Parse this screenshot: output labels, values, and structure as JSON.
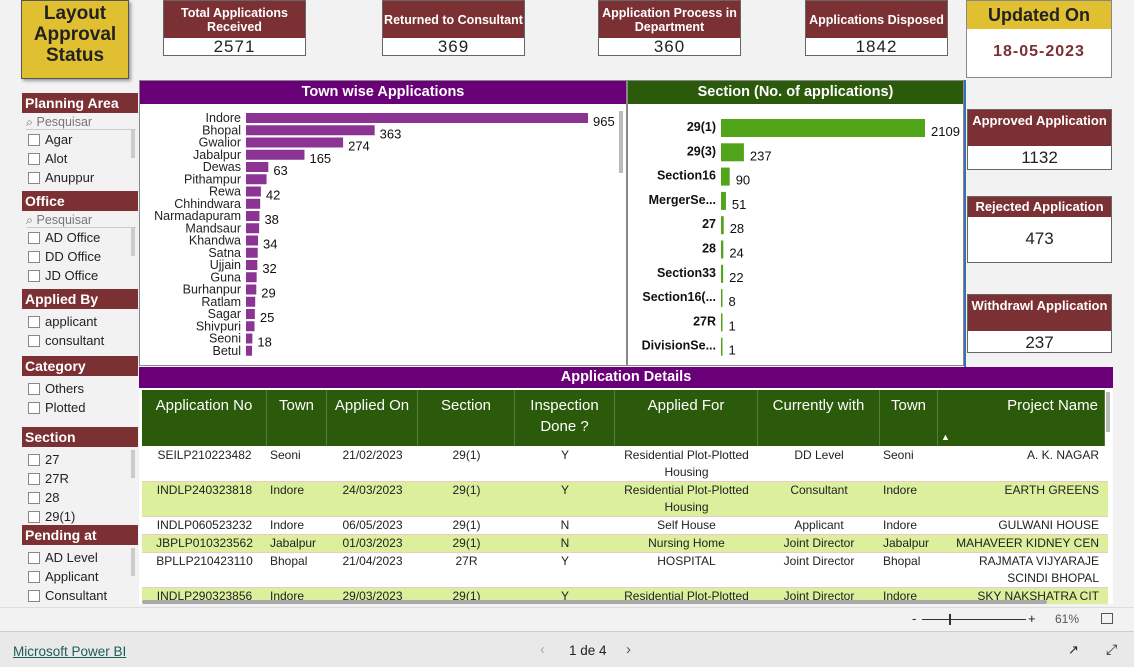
{
  "title": "Layout Approval Status",
  "kpis": [
    {
      "label": "Total Applications Received",
      "value": "2571"
    },
    {
      "label": "Returned to Consultant",
      "value": "369"
    },
    {
      "label": "Application Process in Department",
      "value": "360"
    },
    {
      "label": "Applications Disposed",
      "value": "1842"
    }
  ],
  "updated": {
    "label": "Updated On",
    "value": "18-05-2023"
  },
  "right_cards": [
    {
      "label": "Approved Application",
      "value": "1132"
    },
    {
      "label": "Rejected Application",
      "value": "473"
    },
    {
      "label": "Withdrawl Application",
      "value": "237"
    }
  ],
  "slicers": {
    "planning_area": {
      "label": "Planning Area",
      "search": "Pesquisar",
      "items": [
        "Agar",
        "Alot",
        "Anuppur"
      ]
    },
    "office": {
      "label": "Office",
      "search": "Pesquisar",
      "items": [
        "AD Office",
        "DD Office",
        "JD Office"
      ]
    },
    "applied_by": {
      "label": "Applied By",
      "items": [
        "applicant",
        "consultant"
      ]
    },
    "category": {
      "label": "Category",
      "items": [
        "Others",
        "Plotted"
      ]
    },
    "section": {
      "label": "Section",
      "items": [
        "27",
        "27R",
        "28",
        "29(1)"
      ]
    },
    "pending_at": {
      "label": "Pending at",
      "items": [
        "AD Level",
        "Applicant",
        "Consultant"
      ]
    }
  },
  "chart_data": [
    {
      "type": "bar",
      "orientation": "horizontal",
      "title": "Town wise Applications",
      "bar_color": "#8b3494",
      "categories": [
        "Indore",
        "Bhopal",
        "Gwalior",
        "Jabalpur",
        "Dewas",
        "Pithampur",
        "Rewa",
        "Chhindwara",
        "Narmadapuram",
        "Mandsaur",
        "Khandwa",
        "Satna",
        "Ujjain",
        "Guna",
        "Burhanpur",
        "Ratlam",
        "Sagar",
        "Shivpuri",
        "Seoni",
        "Betul"
      ],
      "values": [
        965,
        363,
        274,
        165,
        63,
        58,
        42,
        40,
        38,
        37,
        34,
        33,
        32,
        30,
        29,
        26,
        25,
        24,
        18,
        17
      ],
      "data_labels": [
        "965",
        "363",
        "274",
        "165",
        "63",
        "",
        "42",
        "",
        "38",
        "",
        "34",
        "",
        "32",
        "",
        "29",
        "",
        "25",
        "",
        "18",
        ""
      ]
    },
    {
      "type": "bar",
      "orientation": "horizontal",
      "title": "Section (No. of applications)",
      "bar_color": "#52a41a",
      "categories": [
        "29(1)",
        "29(3)",
        "Section16",
        "MergerSe...",
        "27",
        "28",
        "Section33",
        "Section16(...",
        "27R",
        "DivisionSe..."
      ],
      "values": [
        2109,
        237,
        90,
        51,
        28,
        24,
        22,
        8,
        1,
        1
      ]
    }
  ],
  "table": {
    "title": "Application Details",
    "columns": [
      "Application No",
      "Town",
      "Applied On",
      "Section",
      "Inspection Done ?",
      "Applied For",
      "Currently with",
      "Town",
      "Project Name"
    ],
    "rows": [
      [
        "SEILP210223482",
        "Seoni",
        "21/02/2023",
        "29(1)",
        "Y",
        "Residential Plot-Plotted Housing",
        "DD Level",
        "Seoni",
        "A. K. NAGAR"
      ],
      [
        "INDLP240323818",
        "Indore",
        "24/03/2023",
        "29(1)",
        "Y",
        "Residential Plot-Plotted Housing",
        "Consultant",
        "Indore",
        "EARTH GREENS"
      ],
      [
        "INDLP060523232",
        "Indore",
        "06/05/2023",
        "29(1)",
        "N",
        "Self House",
        "Applicant",
        "Indore",
        "GULWANI HOUSE"
      ],
      [
        "JBPLP010323562",
        "Jabalpur",
        "01/03/2023",
        "29(1)",
        "N",
        "Nursing Home",
        "Joint Director",
        "Jabalpur",
        "MAHAVEER KIDNEY CEN"
      ],
      [
        "BPLLP210423110",
        "Bhopal",
        "21/04/2023",
        "27R",
        "Y",
        "HOSPITAL",
        "Joint Director",
        "Bhopal",
        "RAJMATA VIJYARAJE SCINDI BHOPAL"
      ],
      [
        "INDLP290323856",
        "Indore",
        "29/03/2023",
        "29(1)",
        "Y",
        "Residential Plot-Plotted",
        "Joint Director",
        "Indore",
        "SKY NAKSHATRA CIT"
      ]
    ]
  },
  "footer": {
    "brand": "Microsoft Power BI",
    "page": "1 de 4",
    "zoom": "61%",
    "zoom_minus": "-",
    "zoom_plus": "+"
  },
  "colors": {
    "maroon": "#7b3033",
    "purple": "#6a0078",
    "green_dark": "#2b5a0a",
    "row_alt": "#dcef9c",
    "gold": "#e0c030"
  }
}
